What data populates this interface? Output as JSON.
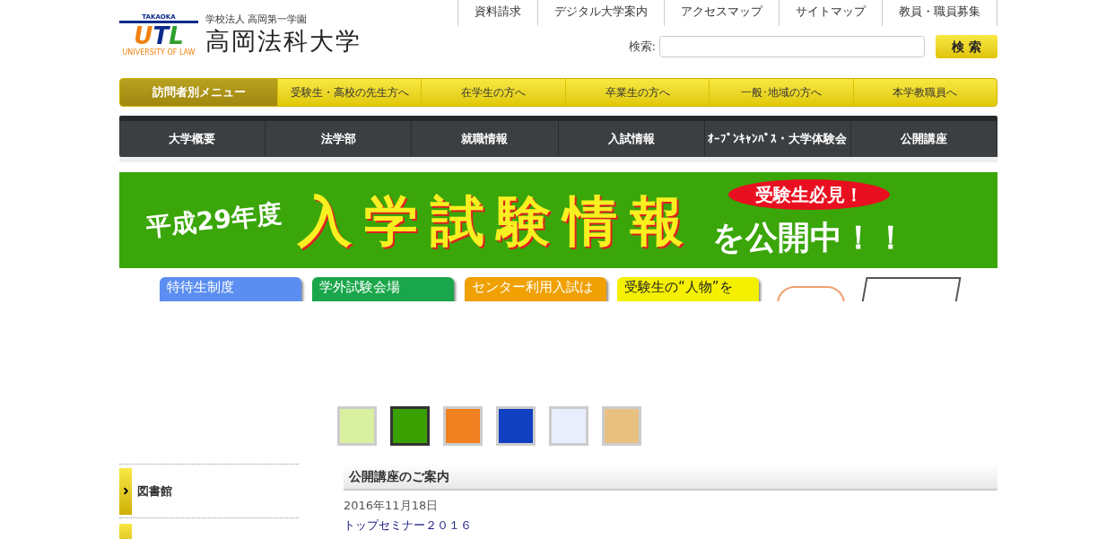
{
  "top_links": [
    "資料請求",
    "デジタル大学案内",
    "アクセスマップ",
    "サイトマップ",
    "教員・職員募集"
  ],
  "logo": {
    "org": "学校法人 高岡第一学園",
    "name": "高岡法科大学",
    "mark_top": "TAKAOKA",
    "mark_letters": [
      "U",
      "T",
      "L"
    ],
    "mark_bottom": "UNIVERSITY OF LAW"
  },
  "search": {
    "label": "検索:",
    "button": "検 索"
  },
  "visitor_menu": {
    "title": "訪問者別メニュー",
    "items": [
      "受験生・高校の先生方へ",
      "在学生の方へ",
      "卒業生の方へ",
      "一般･地域の方へ",
      "本学教職員へ"
    ]
  },
  "main_nav": [
    "大学概要",
    "法学部",
    "就職情報",
    "入試情報",
    "ｵｰﾌﾟﾝｷｬﾝﾊﾟｽ・大学体験会",
    "公開講座"
  ],
  "banner": {
    "year": "平成29年度",
    "headline": "入学試験情報",
    "badge": "受験生必見！",
    "tail": "を公開中！！"
  },
  "cards": [
    {
      "label": "特待生制度",
      "color": "#5b8ef0"
    },
    {
      "label": "学外試験会場",
      "color": "#1aa64a"
    },
    {
      "label": "センター利用入試は",
      "color": "#f0a000"
    },
    {
      "label": "受験生の“人物”を",
      "color": "#f5f000"
    }
  ],
  "thumbnails": [
    {
      "selected": false,
      "color": "#d8f0a0"
    },
    {
      "selected": true,
      "color": "#3aa000"
    },
    {
      "selected": false,
      "color": "#f08020"
    },
    {
      "selected": false,
      "color": "#1040c0"
    },
    {
      "selected": false,
      "color": "#e8eefc"
    },
    {
      "selected": false,
      "color": "#e8c080"
    }
  ],
  "sidebar": {
    "items": [
      "図書館"
    ]
  },
  "news": {
    "title": "公開講座のご案内",
    "items": [
      {
        "date": "2016年11月18日",
        "title": "トップセミナー２０１６"
      }
    ]
  }
}
